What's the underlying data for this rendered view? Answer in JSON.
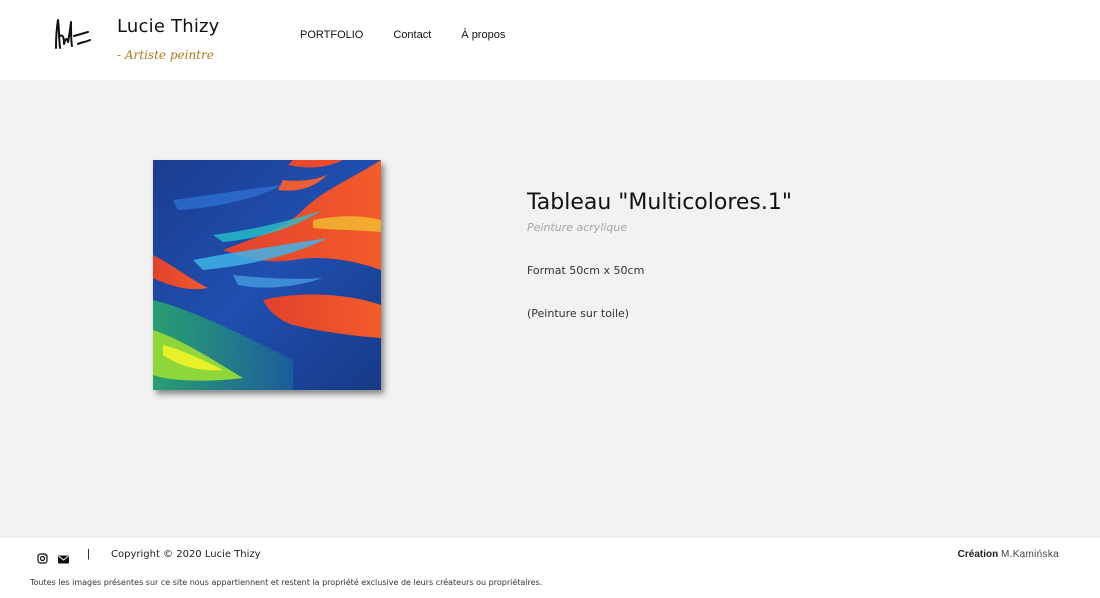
{
  "header": {
    "logo_icon": "signature-logo-icon",
    "brand_name": "Lucie Thizy",
    "brand_tagline": "- Artiste peintre",
    "tagline_color": "#b07a1e"
  },
  "nav": {
    "items": [
      {
        "label": "PORTFOLIO"
      },
      {
        "label": "Contact"
      },
      {
        "label": "À propos"
      }
    ]
  },
  "artwork": {
    "image_icon": "painting-image",
    "title": "Tableau \"Multicolores.1\"",
    "medium": "Peinture acrylique",
    "format": "Format 50cm x 50cm",
    "support": "(Peinture sur toile)"
  },
  "footer": {
    "icons": [
      "instagram-icon",
      "envelope-icon"
    ],
    "separator": "|",
    "copyright": "Copyright © 2020 Lucie Thizy",
    "credit_label": "Création",
    "credit_author": "M.Kamińska",
    "disclaimer": "Toutes les images présentes sur ce site nous appartiennent et restent la propriété exclusive de leurs créateurs ou propriétaires."
  },
  "colors": {
    "content_background": "#f2f2f2",
    "header_background": "#ffffff"
  }
}
